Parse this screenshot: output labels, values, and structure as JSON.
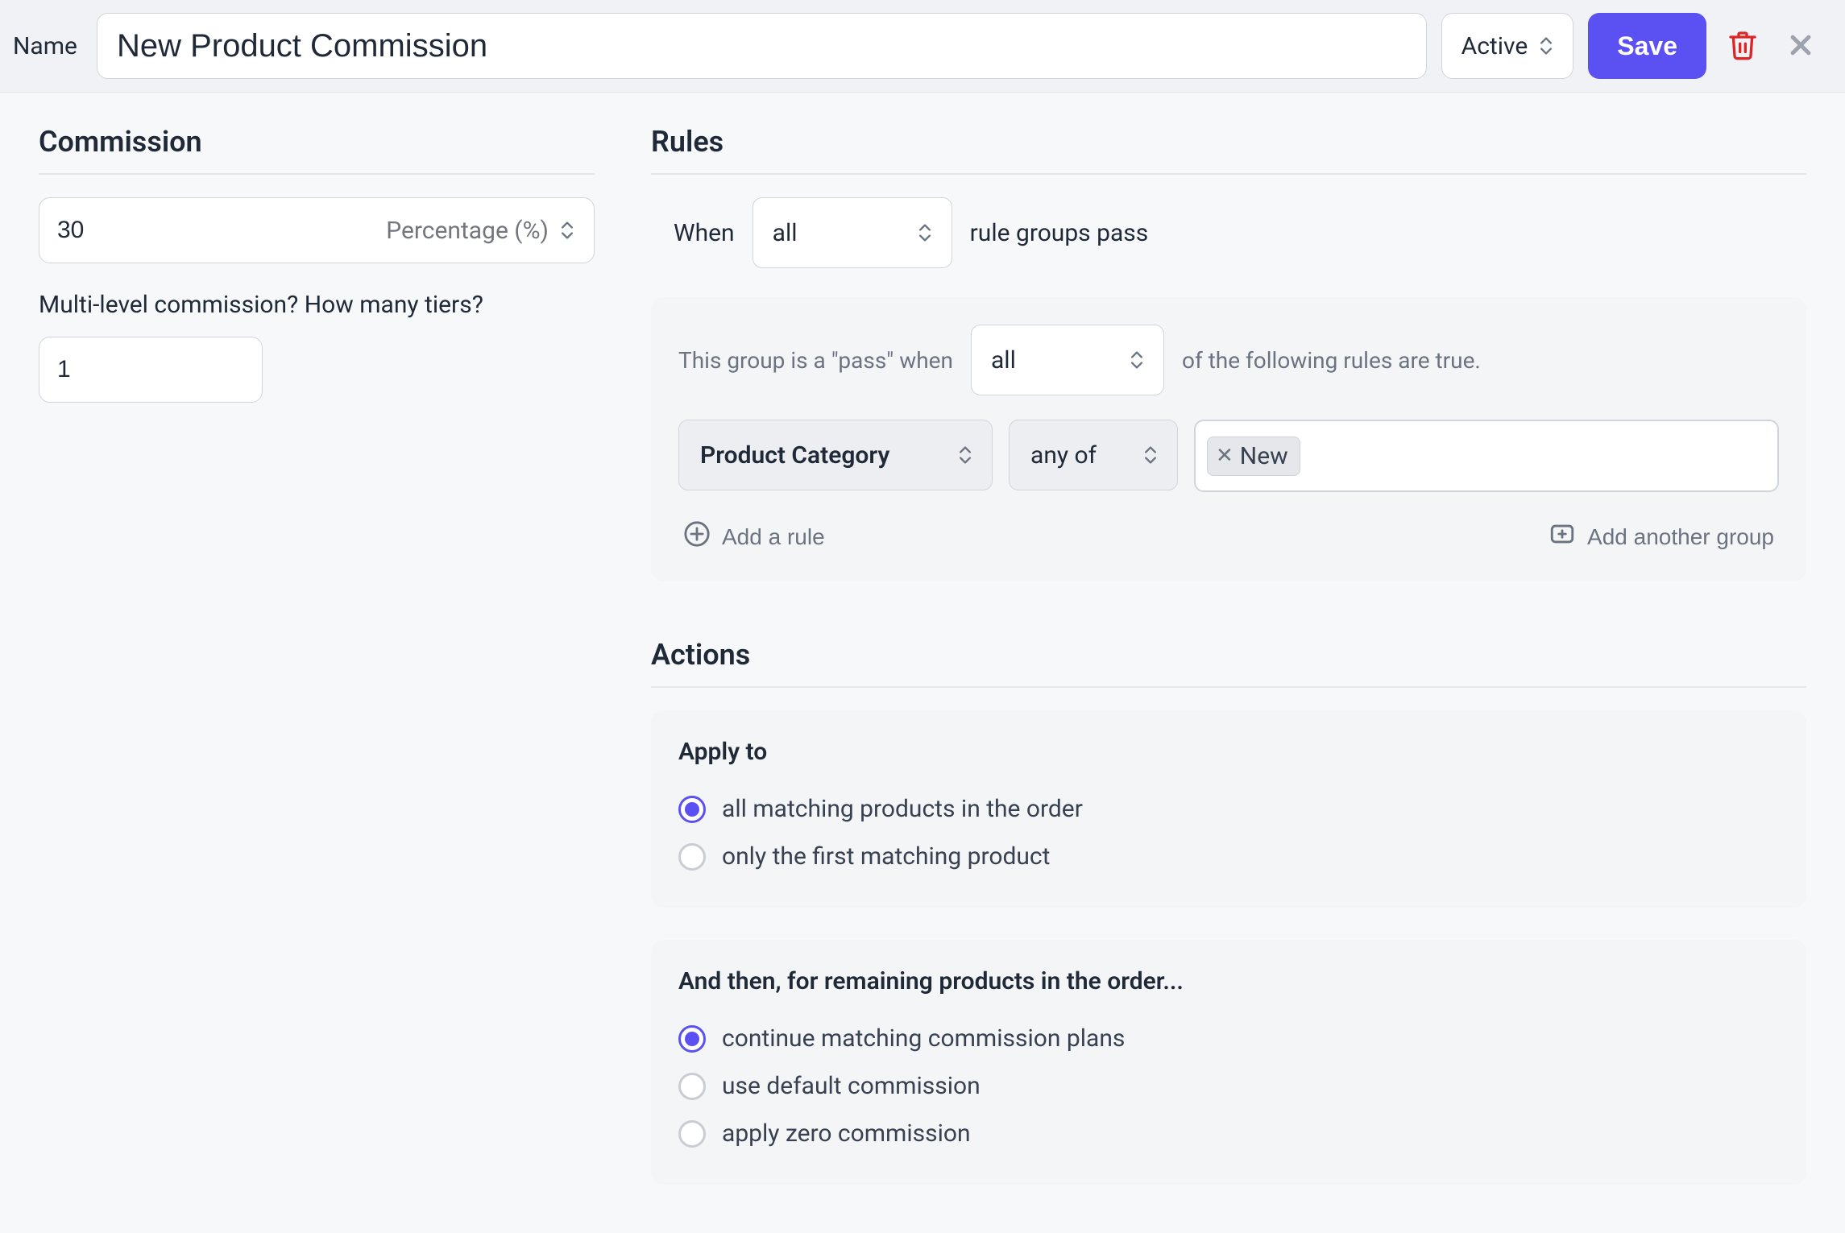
{
  "header": {
    "name_label": "Name",
    "name_value": "New Product Commission",
    "status_label": "Active",
    "save_label": "Save"
  },
  "commission": {
    "title": "Commission",
    "value": "30",
    "unit_label": "Percentage (%)",
    "tiers_label": "Multi-level commission? How many tiers?",
    "tiers_value": "1"
  },
  "rules": {
    "title": "Rules",
    "when_prefix": "When",
    "when_select": "all",
    "when_suffix": "rule groups pass",
    "group": {
      "prefix": "This group is a \"pass\" when",
      "select": "all",
      "suffix": "of the following rules are true.",
      "field_select": "Product Category",
      "op_select": "any of",
      "tag_value": "New"
    },
    "add_rule_label": "Add a rule",
    "add_group_label": "Add another group"
  },
  "actions": {
    "title": "Actions",
    "apply": {
      "title": "Apply to",
      "opt_all": "all matching products in the order",
      "opt_first": "only the first matching product",
      "selected": "all"
    },
    "then": {
      "title": "And then, for remaining products in the order...",
      "opt_continue": "continue matching commission plans",
      "opt_default": "use default commission",
      "opt_zero": "apply zero commission",
      "selected": "continue"
    }
  }
}
